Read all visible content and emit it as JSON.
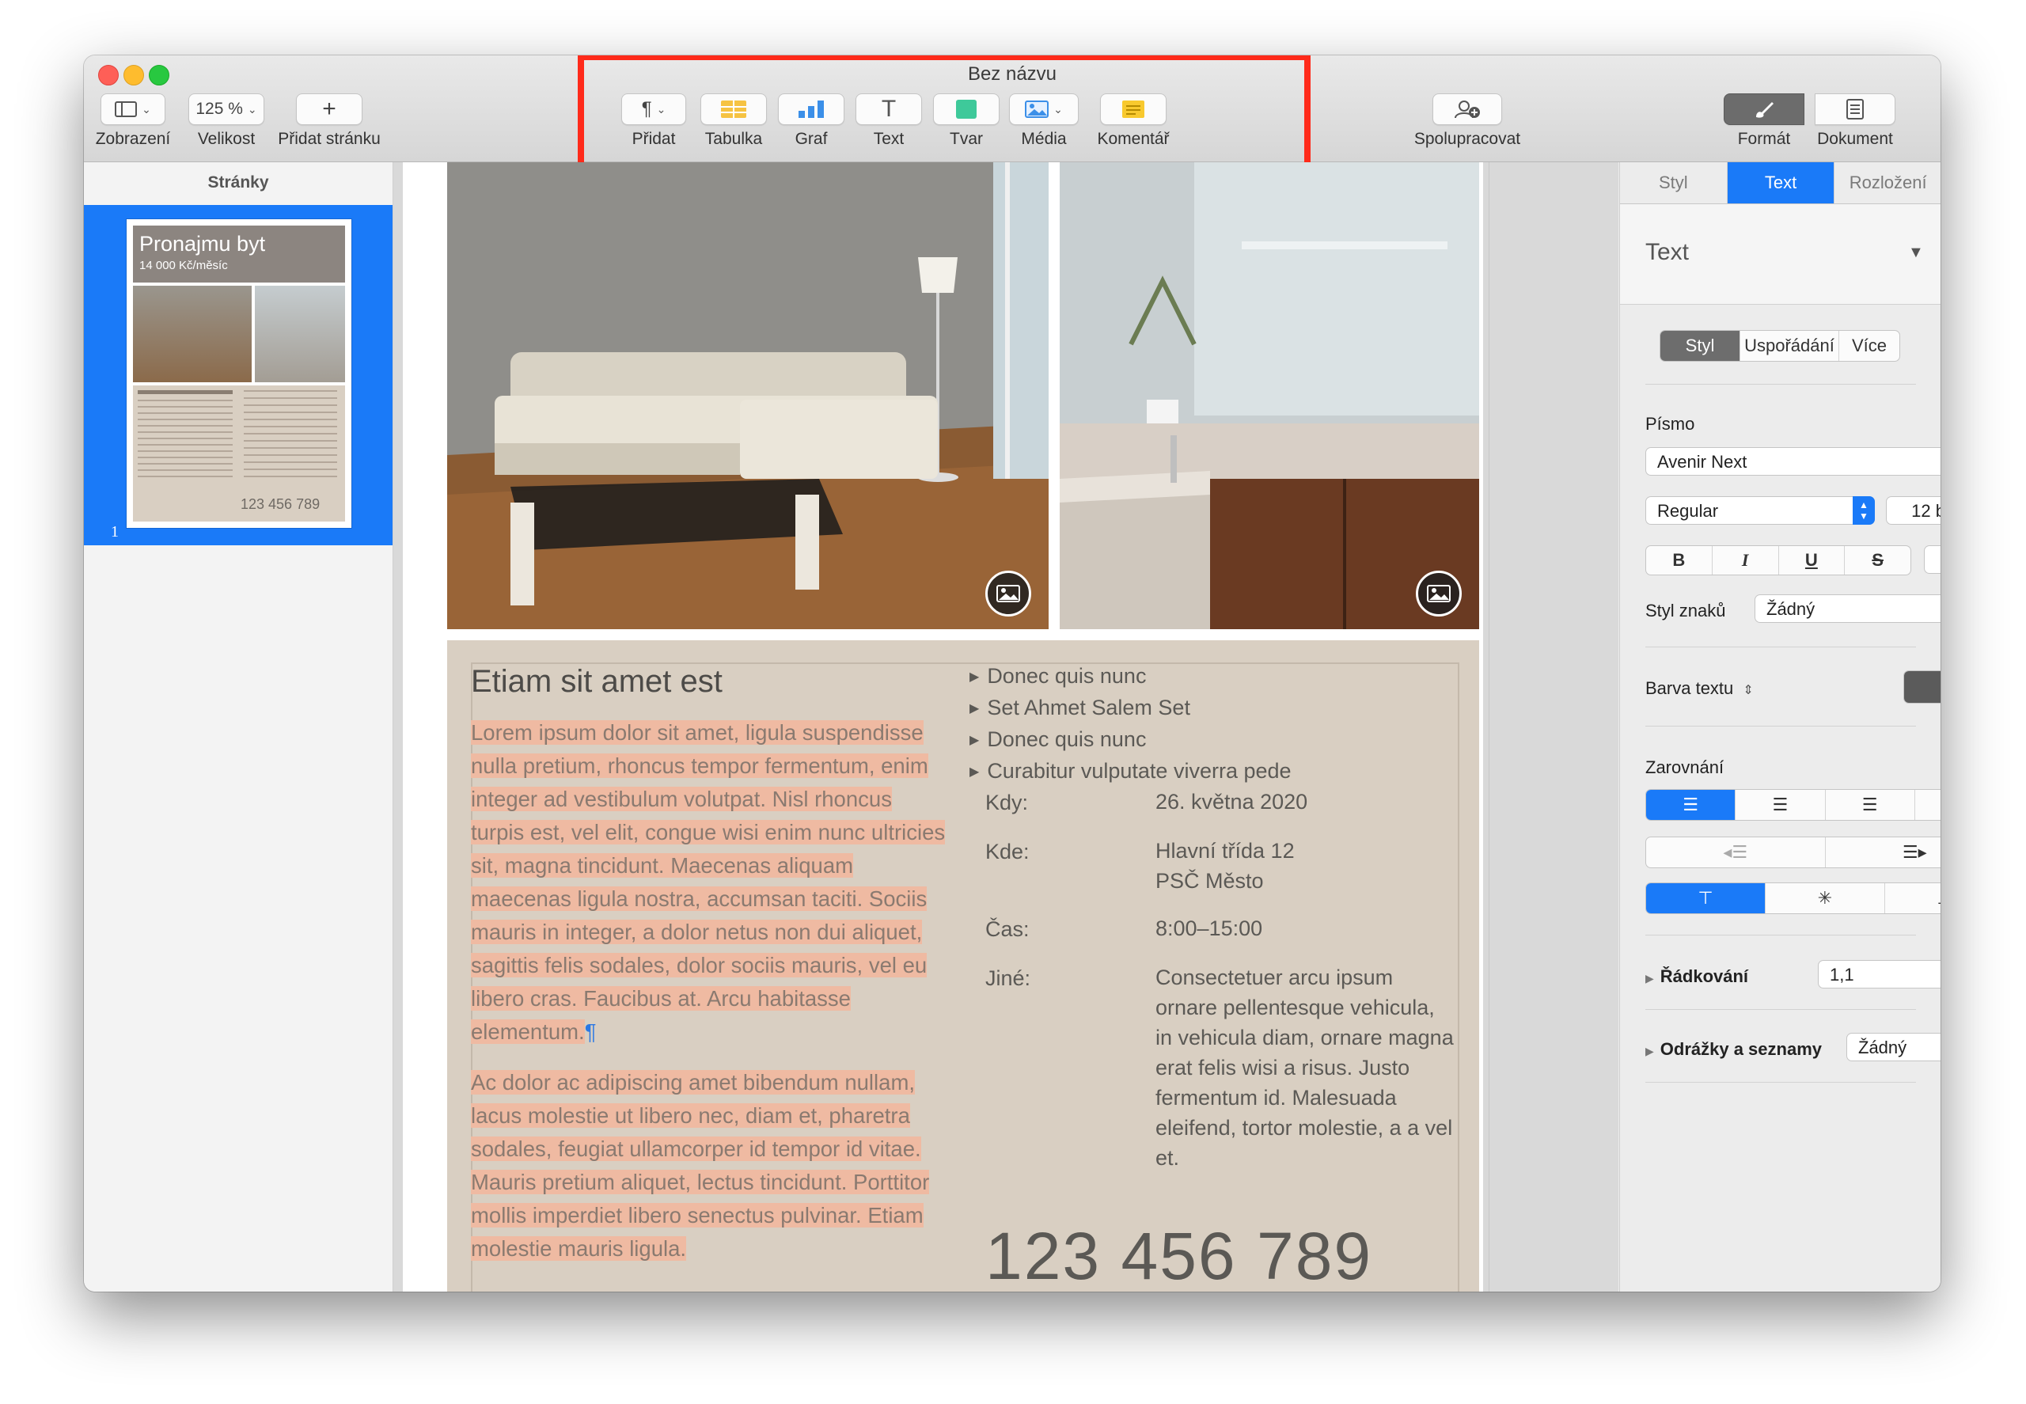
{
  "window": {
    "title": "Bez názvu"
  },
  "toolbar": {
    "view_label": "Zobrazení",
    "zoom_value": "125 %",
    "zoom_label": "Velikost",
    "add_page_label": "Přidat stránku",
    "insert_label": "Přidat",
    "table_label": "Tabulka",
    "chart_label": "Graf",
    "text_label": "Text",
    "shape_label": "Tvar",
    "media_label": "Média",
    "comment_label": "Komentář",
    "collaborate_label": "Spolupracovat",
    "format_label": "Formát",
    "document_label": "Dokument"
  },
  "sidebar": {
    "title": "Stránky",
    "page_number": "1",
    "thumb": {
      "title": "Pronajmu byt",
      "subtitle": "14 000 Kč/měsíc",
      "phone": "123 456 789"
    }
  },
  "document": {
    "heading": "Etiam sit amet est",
    "para1": "Lorem ipsum dolor sit amet, ligula suspendisse nulla pretium, rhoncus tempor fermentum, enim integer ad vestibulum volutpat. Nisl rhoncus turpis est, vel elit, congue wisi enim nunc ultricies sit, magna tincidunt. Maecenas aliquam maecenas ligula nostra, accumsan taciti. Sociis mauris in integer, a dolor netus non dui aliquet, sagittis felis sodales, dolor sociis mauris, vel eu libero cras. Faucibus at. Arcu habitasse elementum.",
    "pilcrow": "¶",
    "para2": "Ac dolor ac adipiscing amet bibendum nullam, lacus molestie ut libero nec, diam et, pharetra sodales, feugiat ullamcorper id tempor id vitae. Mauris pretium aliquet, lectus tincidunt. Porttitor mollis imperdiet libero senectus pulvinar. Etiam molestie mauris ligula.",
    "bullets": [
      "Donec quis nunc",
      "Set Ahmet Salem Set",
      "Donec quis nunc",
      "Curabitur vulputate viverra pede"
    ],
    "when_label": "Kdy:",
    "when_value": "26. května 2020",
    "where_label": "Kde:",
    "where_line1": "Hlavní třída 12",
    "where_line2": "PSČ Město",
    "time_label": "Čas:",
    "time_value": "8:00–15:00",
    "other_label": "Jiné:",
    "other_value": "Consectetuer arcu ipsum ornare pellentesque vehicula, in vehicula diam, ornare magna erat felis wisi a risus. Justo fermentum id. Malesuada eleifend, tortor molestie, a a vel et.",
    "phone": "123 456 789"
  },
  "inspector": {
    "tabs": [
      "Styl",
      "Text",
      "Rozložení"
    ],
    "paragraph_style": "Text",
    "subtabs": [
      "Styl",
      "Uspořádání",
      "Více"
    ],
    "font_section": "Písmo",
    "font_family": "Avenir Next",
    "font_weight": "Regular",
    "font_size": "12 b",
    "bold": "B",
    "italic": "I",
    "underline": "U",
    "strike": "S",
    "char_style_label": "Styl znaků",
    "char_style_value": "Žádný",
    "text_color_label": "Barva textu",
    "align_section": "Zarovnání",
    "line_spacing_label": "Řádkování",
    "line_spacing_value": "1,1",
    "bullets_label": "Odrážky a seznamy",
    "bullets_value": "Žádný"
  },
  "colors": {
    "accent": "#1a7af8",
    "highlight": "#efbaa2",
    "annotation_box": "#ff2a1a",
    "panel_bg": "#d9cfc2"
  }
}
